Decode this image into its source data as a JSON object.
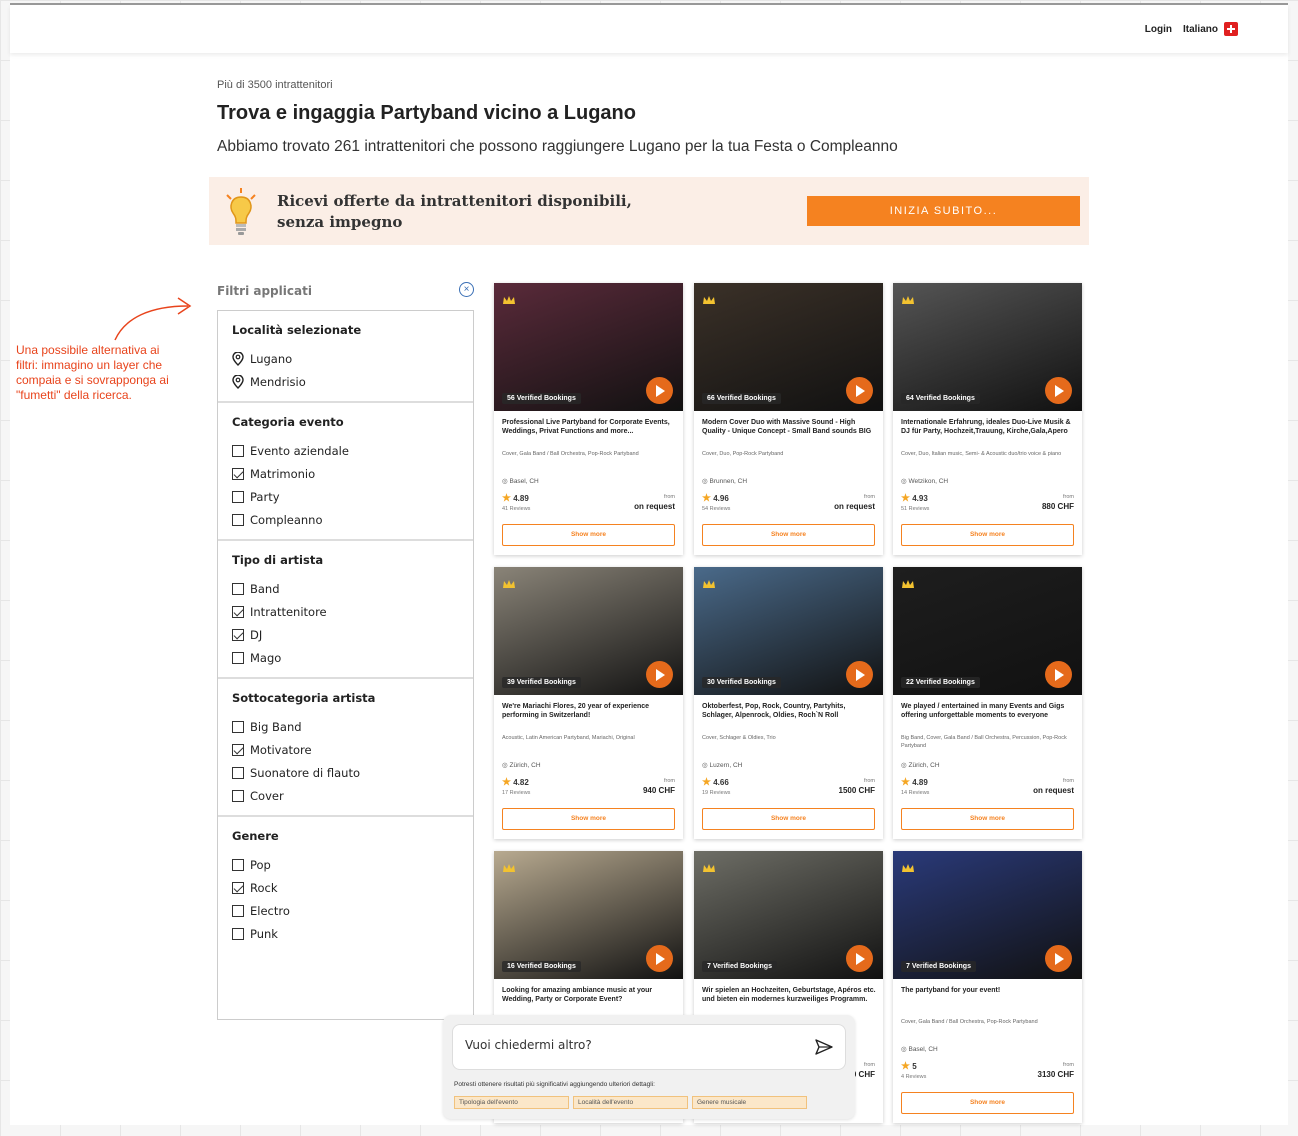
{
  "header": {
    "login": "Login",
    "language": "Italiano"
  },
  "page": {
    "kicker": "Più di 3500 intrattenitori",
    "title": "Trova e ingaggia Partyband vicino a Lugano",
    "subtitle": "Abbiamo trovato 261 intrattenitori che possono raggiungere Lugano per la tua Festa o Compleanno"
  },
  "banner": {
    "text": "Ricevi offerte da intrattenitori disponibili, senza impegno",
    "button": "INIZIA SUBITO..."
  },
  "annotation": "Una possibile alternativa ai filtri: immagino un layer che compaia e si sovrapponga ai \"fumetti\" della ricerca.",
  "filters": {
    "heading": "Filtri applicati",
    "sections": [
      {
        "title": "Località selezionate",
        "type": "location",
        "items": [
          {
            "label": "Lugano"
          },
          {
            "label": "Mendrisio"
          }
        ]
      },
      {
        "title": "Categoria evento",
        "type": "checkbox",
        "items": [
          {
            "label": "Evento aziendale",
            "checked": false
          },
          {
            "label": "Matrimonio",
            "checked": true
          },
          {
            "label": "Party",
            "checked": false
          },
          {
            "label": "Compleanno",
            "checked": false
          }
        ]
      },
      {
        "title": "Tipo di artista",
        "type": "checkbox",
        "items": [
          {
            "label": "Band",
            "checked": false
          },
          {
            "label": "Intrattenitore",
            "checked": true
          },
          {
            "label": "DJ",
            "checked": true
          },
          {
            "label": "Mago",
            "checked": false
          }
        ]
      },
      {
        "title": "Sottocategoria artista",
        "type": "checkbox",
        "items": [
          {
            "label": "Big Band",
            "checked": false
          },
          {
            "label": "Motivatore",
            "checked": true
          },
          {
            "label": "Suonatore di flauto",
            "checked": false
          },
          {
            "label": "Cover",
            "checked": false
          }
        ]
      },
      {
        "title": "Genere",
        "type": "checkbox",
        "items": [
          {
            "label": "Pop",
            "checked": false
          },
          {
            "label": "Rock",
            "checked": true
          },
          {
            "label": "Electro",
            "checked": false
          },
          {
            "label": "Punk",
            "checked": false
          }
        ]
      }
    ]
  },
  "cards": [
    {
      "bookings": "56 Verified Bookings",
      "title": "Professional Live Partyband for Corporate Events, Weddings, Privat Functions and more...",
      "tags": "Cover, Gala Band / Ball Orchestra, Pop-Rock Partyband",
      "location": "Basel, CH",
      "rating": "4.89",
      "reviews": "41 Reviews",
      "from": "from",
      "price": "on request",
      "button": "Show more",
      "color": "#5a2a3a"
    },
    {
      "bookings": "66 Verified Bookings",
      "title": "Modern Cover Duo with Massive Sound - High Quality - Unique Concept - Small Band sounds BIG",
      "tags": "Cover, Duo, Pop-Rock Partyband",
      "location": "Brunnen, CH",
      "rating": "4.96",
      "reviews": "54 Reviews",
      "from": "from",
      "price": "on request",
      "button": "Show more",
      "color": "#3b3128"
    },
    {
      "bookings": "64 Verified Bookings",
      "title": "Internationale Erfahrung, ideales Duo-Live Musik & DJ für Party, Hochzeit,Trauung, Kirche,Gala,Apero",
      "tags": "Cover, Duo, Italian music, Semi- & Acoustic duo/trio voice & piano",
      "location": "Wetzikon, CH",
      "rating": "4.93",
      "reviews": "51 Reviews",
      "from": "from",
      "price": "880 CHF",
      "button": "Show more",
      "color": "#555555"
    },
    {
      "bookings": "39 Verified Bookings",
      "title": "We're Mariachi Flores, 20 year of experience performing in Switzerland!",
      "tags": "Acoustic, Latin American Partyband, Mariachi, Original",
      "location": "Zürich, CH",
      "rating": "4.82",
      "reviews": "17 Reviews",
      "from": "from",
      "price": "940 CHF",
      "button": "Show more",
      "color": "#8a8478"
    },
    {
      "bookings": "30 Verified Bookings",
      "title": "Oktoberfest, Pop, Rock, Country, Partyhits, Schlager, Alpenrock, Oldies, Roch`N Roll",
      "tags": "Cover, Schlager & Oldies, Trio",
      "location": "Luzern, CH",
      "rating": "4.66",
      "reviews": "19 Reviews",
      "from": "from",
      "price": "1500 CHF",
      "button": "Show more",
      "color": "#4a6a8a"
    },
    {
      "bookings": "22 Verified Bookings",
      "title": "We played / entertained in many Events and Gigs offering unforgettable moments to everyone",
      "tags": "Big Band, Cover, Gala Band / Ball Orchestra, Percussion, Pop-Rock Partyband",
      "location": "Zürich, CH",
      "rating": "4.89",
      "reviews": "14 Reviews",
      "from": "from",
      "price": "on request",
      "button": "Show more",
      "color": "#1e1e1e"
    },
    {
      "bookings": "16 Verified Bookings",
      "title": "Looking for amazing ambiance music at your Wedding, Party or Corporate Event?",
      "tags": "",
      "location": "",
      "rating": "",
      "reviews": "",
      "from": "",
      "price": "",
      "button": "",
      "color": "#b8aa90"
    },
    {
      "bookings": "7 Verified Bookings",
      "title": "Wir spielen an Hochzeiten, Geburtstage, Apéros etc. und bieten ein modernes kurzweiliges Programm.",
      "tags": "",
      "location": "",
      "rating": "",
      "reviews": "",
      "from": "from",
      "price": "0 CHF",
      "button": "",
      "color": "#6e6e66"
    },
    {
      "bookings": "7 Verified Bookings",
      "title": "The partyband for your event!",
      "tags": "Cover, Gala Band / Ball Orchestra, Pop-Rock Partyband",
      "location": "Basel, CH",
      "rating": "5",
      "reviews": "4 Reviews",
      "from": "from",
      "price": "3130 CHF",
      "button": "Show more",
      "color": "#2a3a7a"
    }
  ],
  "chat": {
    "placeholder": "Vuoi chiedermi altro?",
    "hint": "Potresti ottenere risultati più significativi aggiungendo ulteriori dettagli:",
    "chips": [
      "Tipologia dell'evento",
      "Località dell'evento",
      "Genere musicale"
    ]
  }
}
